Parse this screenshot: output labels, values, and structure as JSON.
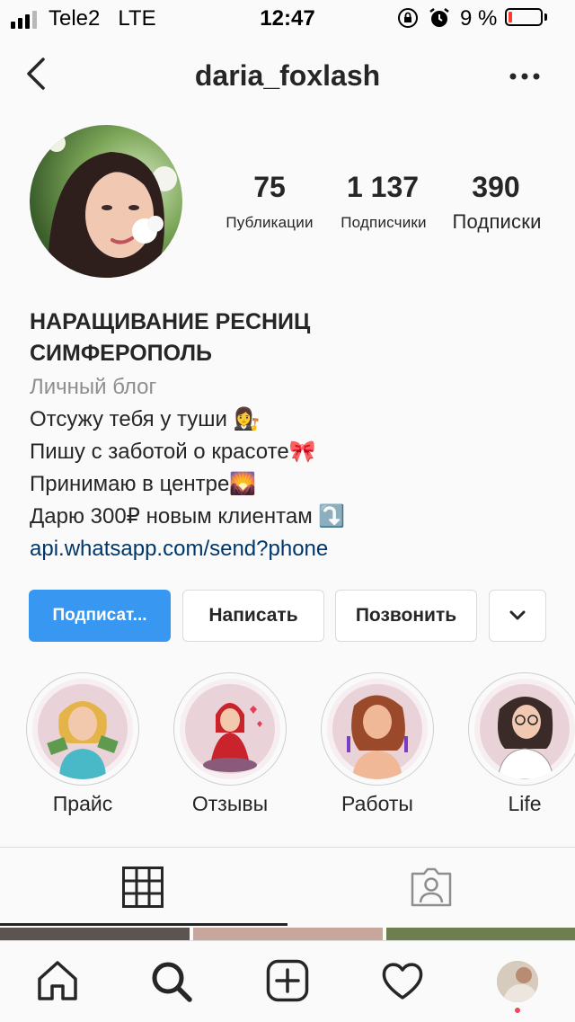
{
  "status_bar": {
    "carrier": "Tele2   LTE",
    "time": "12:47",
    "battery": "9 %"
  },
  "header": {
    "username": "daria_foxlash"
  },
  "stats": [
    {
      "value": "75",
      "label": "Публикации"
    },
    {
      "value": "1 137",
      "label": "Подписчики"
    },
    {
      "value": "390",
      "label": "Подписки"
    }
  ],
  "bio": {
    "title_line1": "НАРАЩИВАНИЕ РЕСНИЦ",
    "title_line2": "СИМФЕРОПОЛЬ",
    "category": "Личный блог",
    "lines": [
      "Отсужу тебя у туши 👩‍⚖️",
      "Пишу с заботой о красоте🎀",
      "Принимаю в центре🌄",
      "Дарю 300₽ новым клиентам ⤵️"
    ],
    "link": "api.whatsapp.com/send?phone"
  },
  "actions": {
    "subscribe": "Подписат...",
    "message": "Написать",
    "call": "Позвонить"
  },
  "highlights": [
    {
      "label": "Прайс"
    },
    {
      "label": "Отзывы"
    },
    {
      "label": "Работы"
    },
    {
      "label": "Life"
    }
  ],
  "colors": {
    "accent": "#3897f0",
    "link": "#00376b",
    "muted": "#8e8e8e",
    "notification_dot": "#ed4956"
  },
  "icons": {
    "back": "chevron-left-icon",
    "more": "more-dots-icon",
    "dropdown": "chevron-down-icon",
    "grid": "grid-icon",
    "tagged": "tagged-person-icon",
    "home": "home-icon",
    "search": "search-icon",
    "new_post": "plus-square-icon",
    "activity": "heart-icon",
    "profile": "profile-avatar"
  }
}
